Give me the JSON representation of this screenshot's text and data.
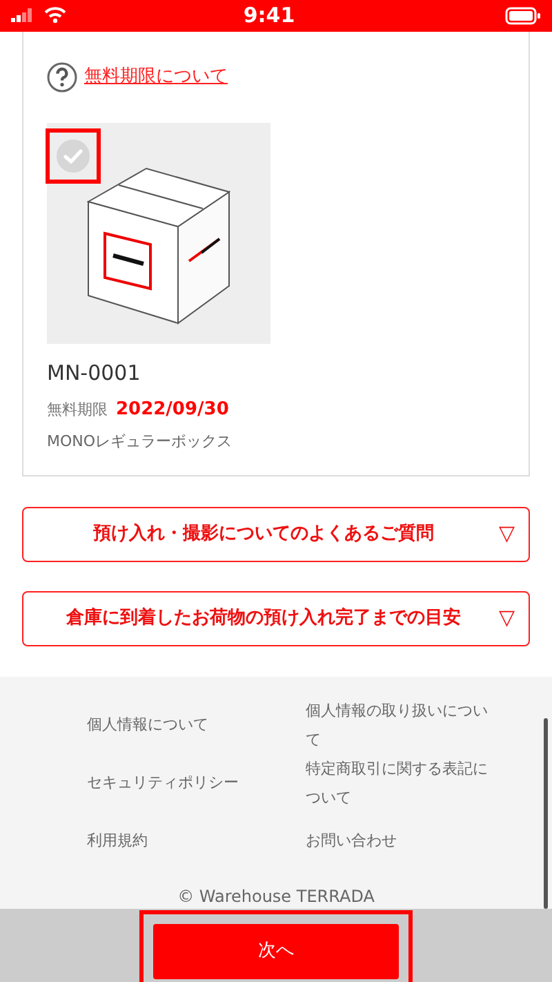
{
  "status_bar": {
    "time": "9:41"
  },
  "help_link": {
    "label": "無料期限について"
  },
  "item": {
    "checked": false,
    "highlighted": true,
    "kind": "picture",
    "id": "MN-0001",
    "expiry_label": "無料期限",
    "expiry_date": "2022/09/30",
    "box_type": "MONOレギュラーボックス"
  },
  "faq_buttons": [
    {
      "label": "預け入れ・撮影についてのよくあるご質問",
      "icon": "▽",
      "expanded": false
    },
    {
      "label": "倉庫に到着したお荷物の預け入れ完了までの目安",
      "icon": "▽",
      "expanded": false
    }
  ],
  "footer_links": [
    {
      "label": "個人情報について"
    },
    {
      "label": "セキュリティポリシー"
    },
    {
      "label": "利用規約"
    },
    {
      "label": "個人情報の取り扱いについて"
    },
    {
      "label": "特定商取引に関する表記について"
    },
    {
      "label": "お問い合わせ"
    }
  ],
  "copyright": "© Warehouse TERRADA",
  "next_button": {
    "label": "次へ",
    "highlighted": true
  }
}
